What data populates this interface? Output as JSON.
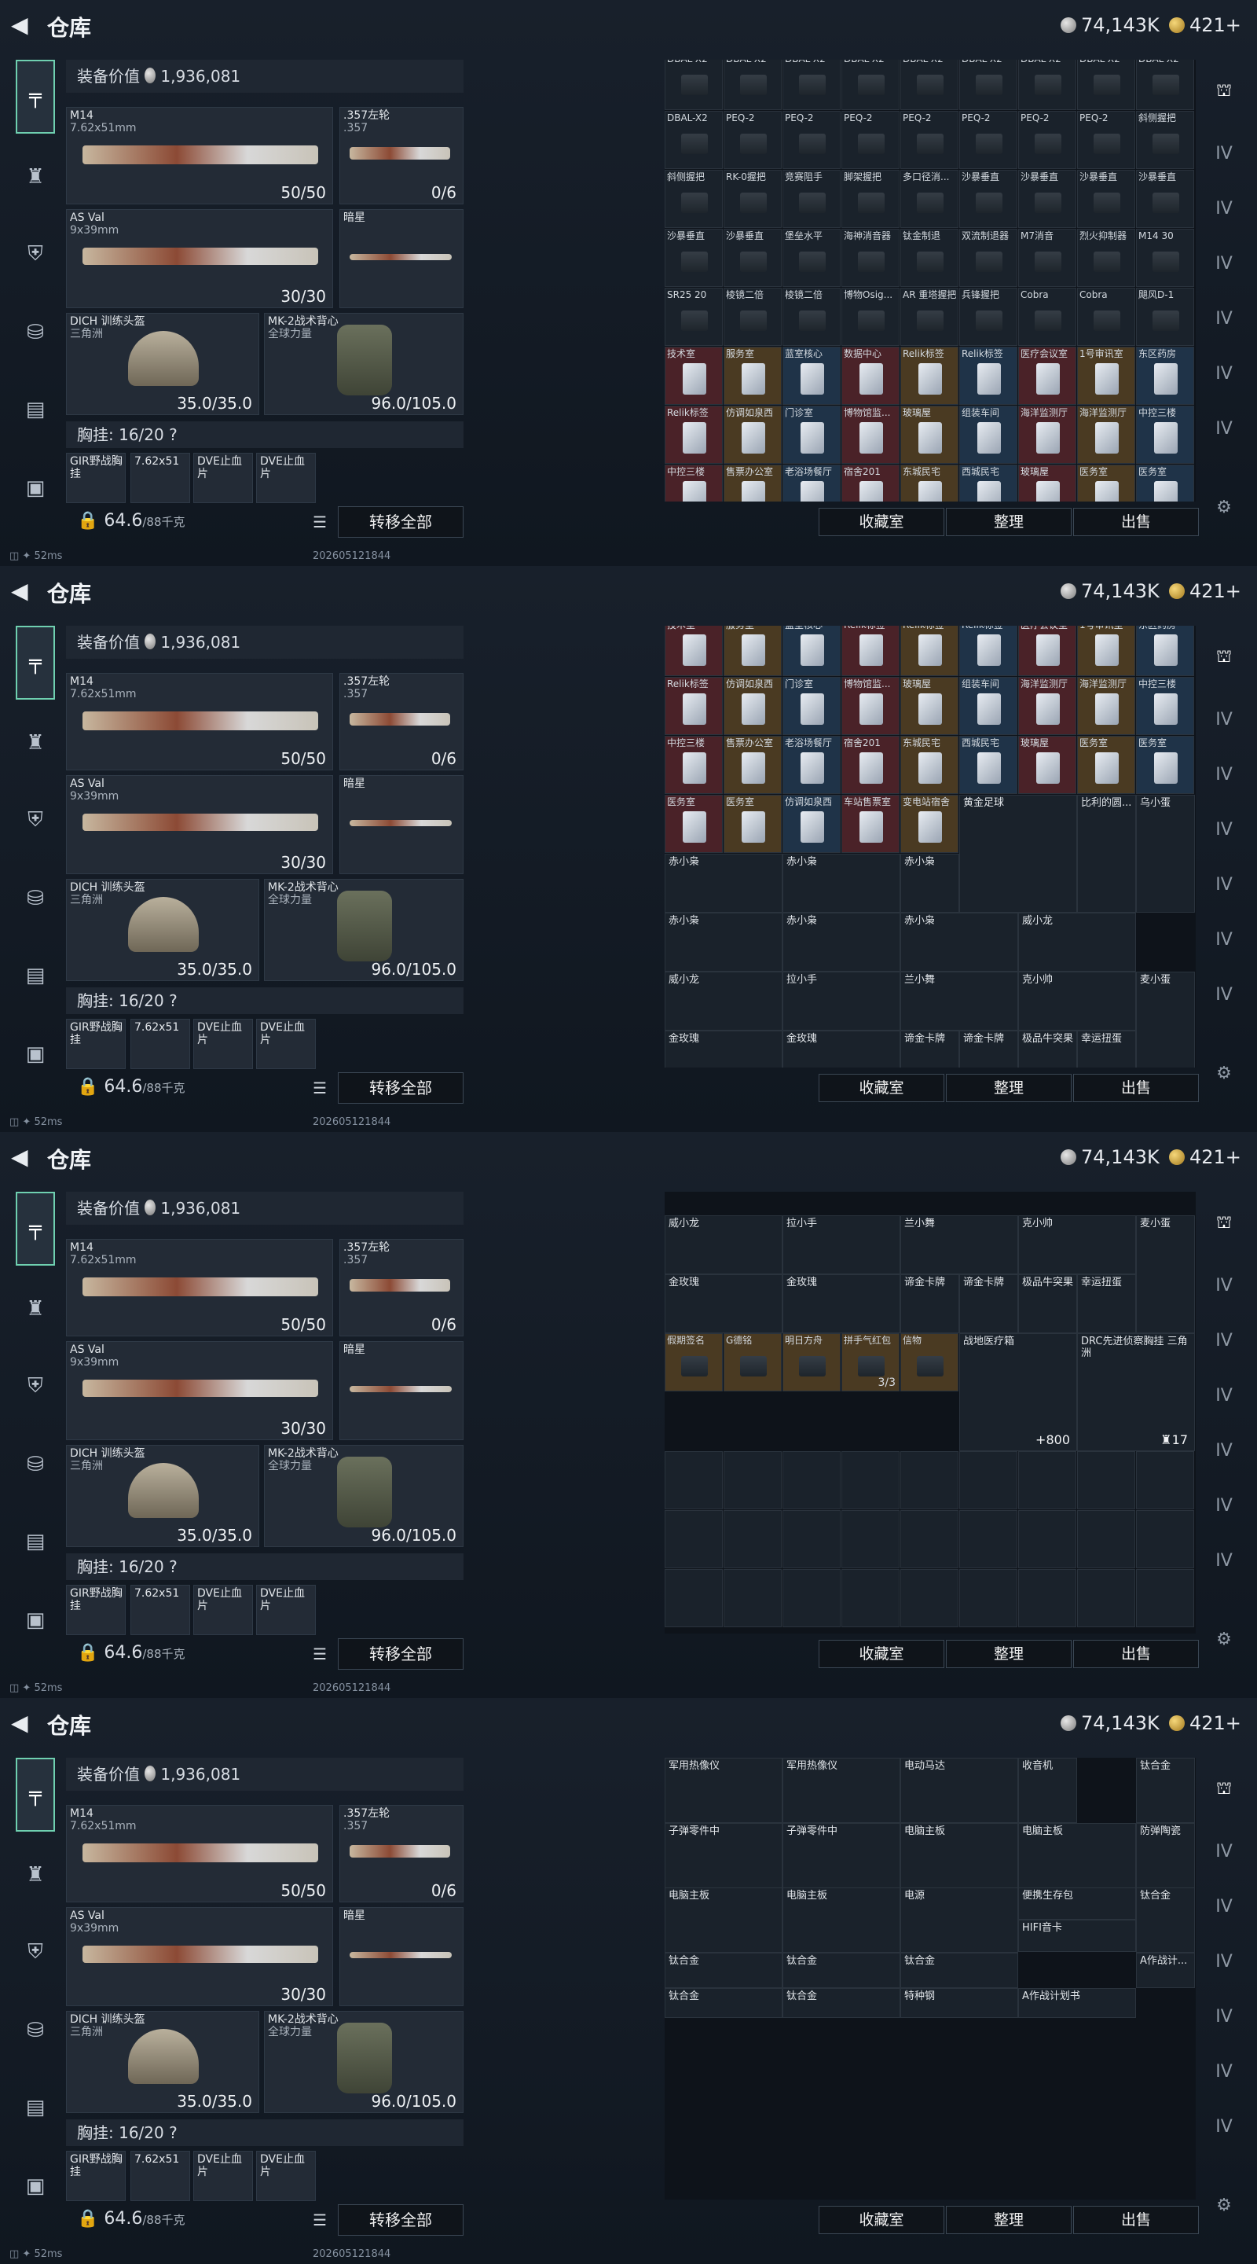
{
  "header": {
    "title": "仓库",
    "silver": "74,143K",
    "gold": "421+"
  },
  "equipment": {
    "value_label": "装备价值",
    "value": "1,936,081",
    "primary": {
      "name": "M14",
      "caliber": "7.62x51mm",
      "ammo": "50/50"
    },
    "sidearm": {
      "name": ".357左轮",
      "caliber": ".357",
      "ammo": "0/6"
    },
    "secondary": {
      "name": "AS Val",
      "caliber": "9x39mm",
      "ammo": "30/30"
    },
    "melee": {
      "name": "暗星"
    },
    "helmet": {
      "name": "DICH 训练头盔",
      "tag": "三角洲",
      "durability": "35.0/35.0"
    },
    "armor": {
      "name": "MK-2战术背心",
      "tag": "全球力量",
      "durability": "96.0/105.0"
    },
    "chest_rig": {
      "label": "胸挂:",
      "capacity": "16/20",
      "help": "?"
    },
    "rig_items": [
      "GIR野战胸挂",
      "7.62x51",
      "DVE止血片",
      "DVE止血片"
    ],
    "weight": "64.6",
    "weight_unit": "/88千克",
    "transfer_all": "转移全部"
  },
  "status": {
    "ping": "52ms",
    "stamp": "202605121844"
  },
  "actions": {
    "collection": "收藏室",
    "sort": "整理",
    "sell": "出售"
  },
  "grids": [
    {
      "cells": [
        "DBAL-X2",
        "DBAL-X2",
        "DBAL-X2",
        "DBAL-X2",
        "DBAL-X2",
        "DBAL-X2",
        "DBAL-X2",
        "DBAL-X2",
        "DBAL-X2",
        "DBAL-X2",
        "PEQ-2",
        "PEQ-2",
        "PEQ-2",
        "PEQ-2",
        "PEQ-2",
        "PEQ-2",
        "PEQ-2",
        "斜侧握把",
        "斜侧握把",
        "RK-0握把",
        "竞赛阻手",
        "脚架握把",
        "多口径消...",
        "沙暴垂直",
        "沙暴垂直",
        "沙暴垂直",
        "沙暴垂直",
        "沙暴垂直",
        "沙暴垂直",
        "堡垒水平",
        "海神消音器",
        "钛金制退",
        "双流制退器",
        "M7消音",
        "烈火抑制器",
        "M14 30",
        "SR25 20",
        "棱镜二倍",
        "棱镜二倍",
        "博物Osig...",
        "AR 重塔握把",
        "兵锋握把",
        "Cobra",
        "Cobra",
        "飓风D-1",
        "技术室",
        "服务室",
        "蓝室核心",
        "数据中心",
        "Relik标签",
        "Relik标签",
        "医疗会议室",
        "1号审讯室",
        "东区药房",
        "Relik标签",
        "仿调如泉西",
        "门诊室",
        "博物馆监...",
        "玻璃屋",
        "组装车间",
        "海洋监测厅",
        "海洋监测厅",
        "中控三楼",
        "中控三楼",
        "售票办公室",
        "老浴场餐厅",
        "宿舍201",
        "东城民宅",
        "西城民宅",
        "玻璃屋",
        "医务室",
        "医务室"
      ]
    },
    {
      "cells": [
        "技术室",
        "服务室",
        "蓝室核心",
        "Relik标签",
        "Relik标签",
        "Relik标签",
        "医疗会议室",
        "1号审讯室",
        "东区药房",
        "Relik标签",
        "仿调如泉西",
        "门诊室",
        "博物馆监...",
        "玻璃屋",
        "组装车间",
        "海洋监测厅",
        "海洋监测厅",
        "中控三楼",
        "中控三楼",
        "售票办公室",
        "老浴场餐厅",
        "宿舍201",
        "东城民宅",
        "西城民宅",
        "玻璃屋",
        "医务室",
        "医务室",
        "医务室",
        "医务室",
        "仿调如泉西",
        "车站售票室",
        "变电站宿舍"
      ],
      "big": [
        "黄金足球",
        "比利的圆...",
        "乌小蛋",
        "赤小枭",
        "赤小枭",
        "赤小枭",
        "赤小枭",
        "赤小枭",
        "赤小枭",
        "威小龙",
        "威小龙",
        "拉小手",
        "兰小舞",
        "克小帅",
        "麦小蛋",
        "金玫瑰",
        "金玫瑰",
        "谛金卡牌",
        "谛金卡牌",
        "极品牛突果",
        "幸运扭蛋"
      ]
    },
    {
      "big": [
        "威小龙",
        "拉小手",
        "兰小舞",
        "克小帅",
        "麦小蛋",
        "金玫瑰",
        "金玫瑰",
        "谛金卡牌",
        "谛金卡牌",
        "极品牛突果",
        "幸运扭蛋"
      ],
      "small": [
        "假期签名",
        "G德铭",
        "明日方舟",
        "拼手气红包",
        "信物"
      ],
      "qty_redpacket": "3/3",
      "medkit": {
        "name": "战地医疗箱",
        "qty": "+800"
      },
      "rig": {
        "name": "DRC先进侦察胸挂",
        "tag": "三角洲",
        "qty": "17"
      }
    },
    {
      "big": [
        "军用热像仪",
        "军用热像仪",
        "电动马达",
        "收音机",
        "子弹零件中",
        "子弹零件中",
        "电脑主板",
        "电脑主板",
        "防弹陶瓷",
        "电脑主板",
        "电脑主板",
        "电源",
        "便携生存包",
        "钛合金",
        "HIFI音卡",
        "钛合金",
        "钛合金",
        "钛合金",
        "钛合金",
        "A作战计...",
        "钛合金",
        "钛合金",
        "特种钢",
        "A作战计划书"
      ]
    }
  ]
}
